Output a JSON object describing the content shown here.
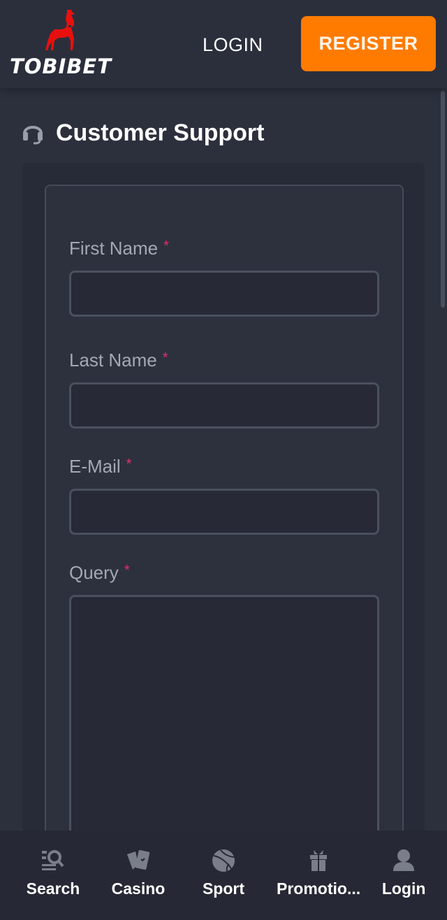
{
  "header": {
    "brand": "TOBIBET",
    "login_label": "LOGIN",
    "register_label": "REGISTER",
    "colors": {
      "accent": "#ff7b00",
      "logo_red": "#e8100e"
    }
  },
  "page": {
    "title": "Customer Support",
    "title_icon": "headset-icon"
  },
  "form": {
    "required_marker": "*",
    "fields": [
      {
        "label": "First Name",
        "value": "",
        "placeholder": ""
      },
      {
        "label": "Last Name",
        "value": "",
        "placeholder": ""
      },
      {
        "label": "E-Mail",
        "value": "",
        "placeholder": ""
      },
      {
        "label": "Query",
        "value": "",
        "placeholder": ""
      }
    ]
  },
  "bottom_nav": {
    "items": [
      {
        "label": "Search",
        "icon": "search-list-icon"
      },
      {
        "label": "Casino",
        "icon": "cards-icon"
      },
      {
        "label": "Sport",
        "icon": "basketball-icon"
      },
      {
        "label": "Promotio...",
        "icon": "gift-icon"
      },
      {
        "label": "Login",
        "icon": "user-icon"
      }
    ]
  }
}
